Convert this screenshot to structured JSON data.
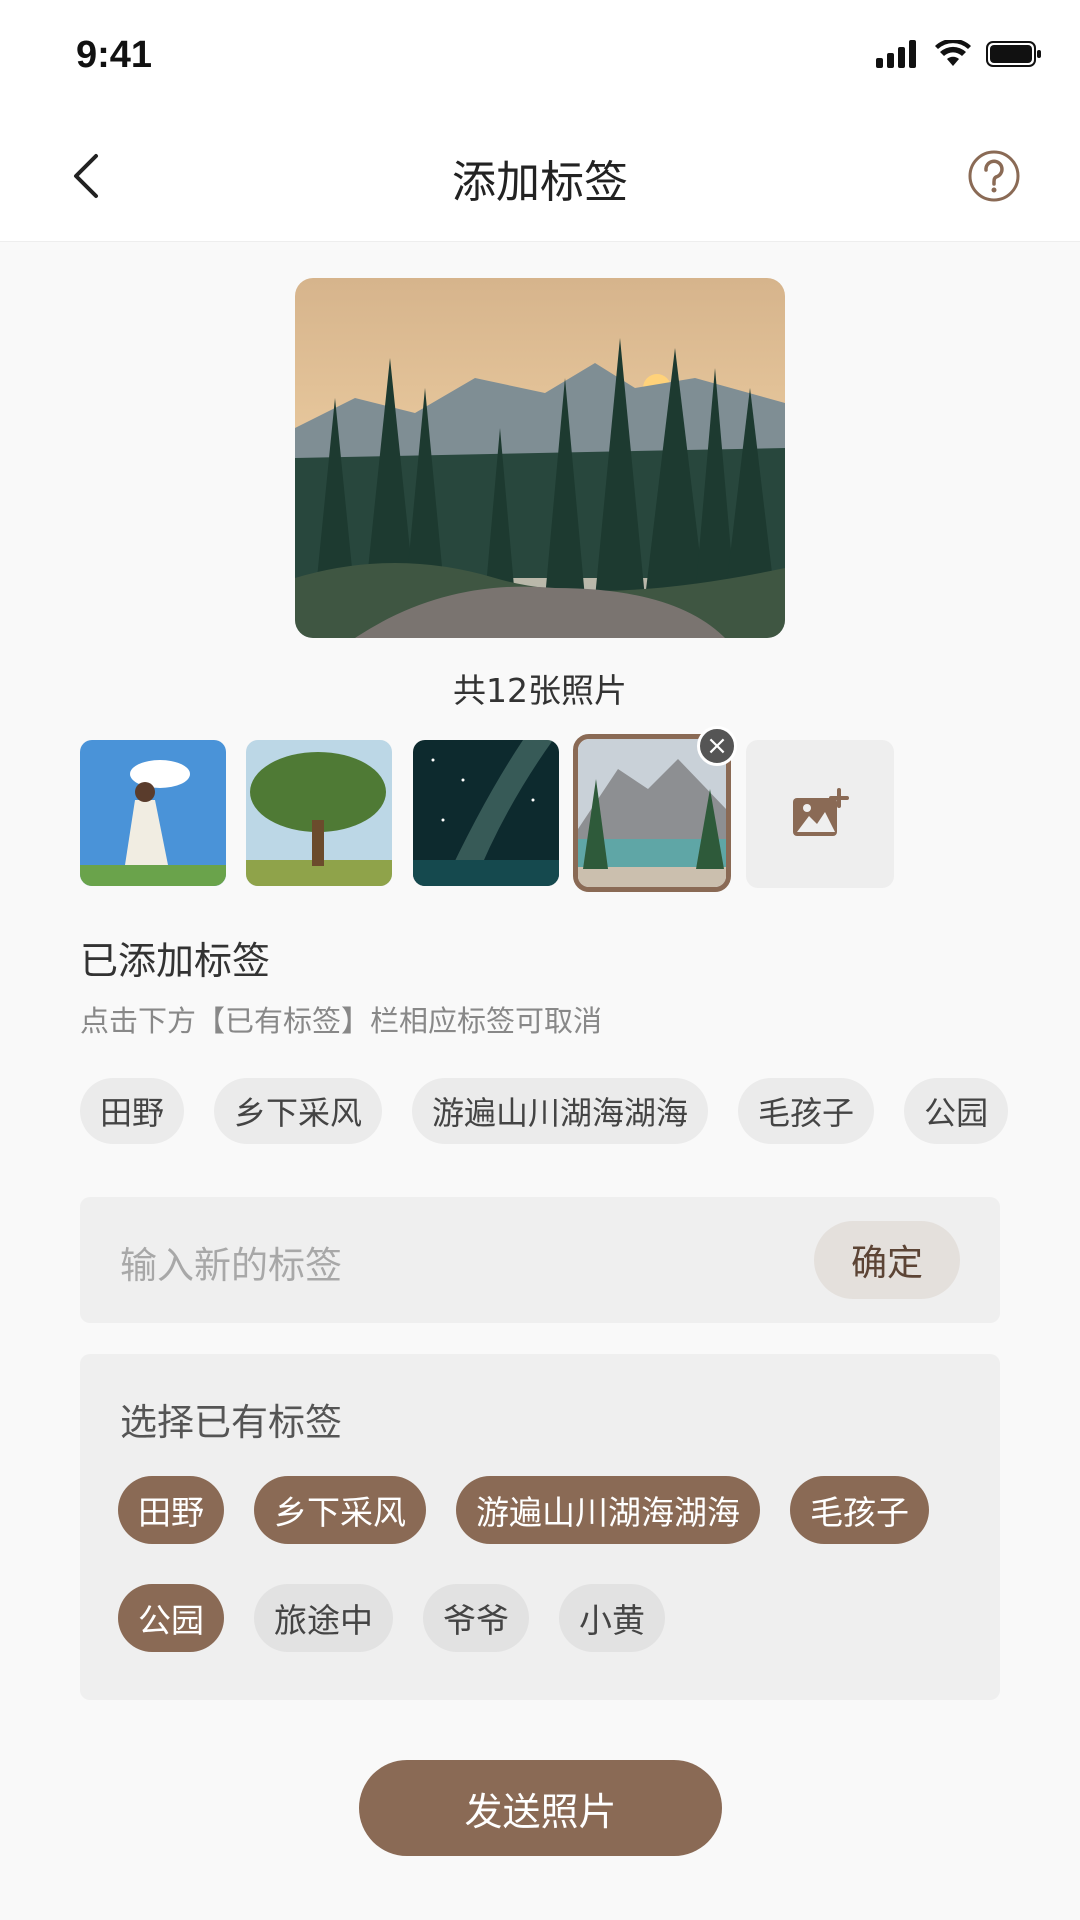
{
  "status_bar": {
    "time": "9:41"
  },
  "nav": {
    "title": "添加标签"
  },
  "photos": {
    "count_text": "共12张照片",
    "thumbnails": [
      "girl-cloud",
      "tree",
      "milky-way",
      "mountain-lake"
    ],
    "selected_index": 3
  },
  "added_section": {
    "title": "已添加标签",
    "hint": "点击下方【已有标签】栏相应标签可取消",
    "tags": [
      "田野",
      "乡下采风",
      "游遍山川湖海湖海",
      "毛孩子",
      "公园"
    ]
  },
  "new_tag": {
    "placeholder": "输入新的标签",
    "confirm_label": "确定"
  },
  "existing_section": {
    "title": "选择已有标签",
    "row1": [
      "田野",
      "乡下采风",
      "游遍山川湖海湖海",
      "毛孩子"
    ],
    "row2": [
      "公园",
      "旅途中",
      "爷爷",
      "小黄"
    ]
  },
  "send_label": "发送照片",
  "colors": {
    "accent": "#8a6a55",
    "chip_off": "#e2e2e2"
  }
}
